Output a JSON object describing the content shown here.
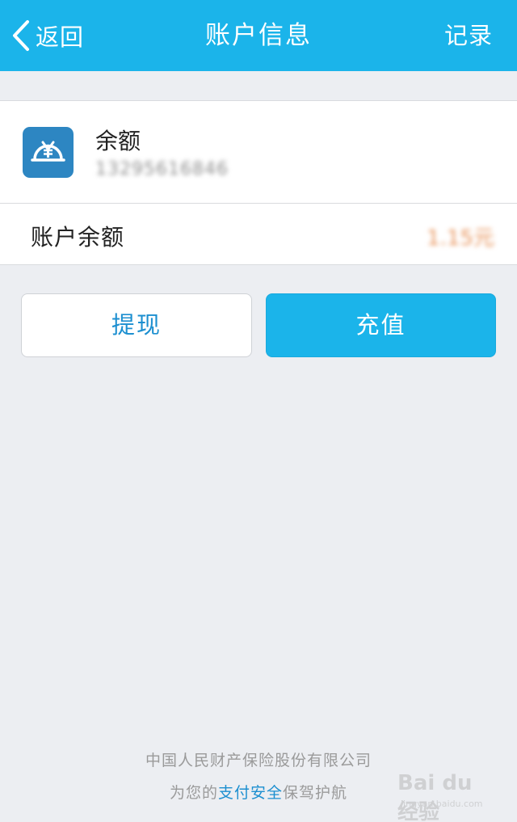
{
  "navbar": {
    "back_label": "返回",
    "title": "账户信息",
    "record_label": "记录",
    "background": "#1bb4ea"
  },
  "account": {
    "icon": "yen-coin-icon",
    "label": "余额",
    "number": "13295616846"
  },
  "balance": {
    "label": "账户余额",
    "value": "1.15元"
  },
  "actions": {
    "withdraw_label": "提现",
    "recharge_label": "充值"
  },
  "footer": {
    "line1": "中国人民财产保险股份有限公司",
    "line2_prefix": "为您的",
    "line2_highlight": "支付安全",
    "line2_suffix": "保驾护航"
  },
  "watermark": {
    "text": "Bai du 经验",
    "sub": "jingyan.baidu.com"
  },
  "colors": {
    "accent": "#1bb4ea",
    "link": "#1c8fd0",
    "page_bg": "#eceef2",
    "icon_bg": "#2d86c2"
  }
}
